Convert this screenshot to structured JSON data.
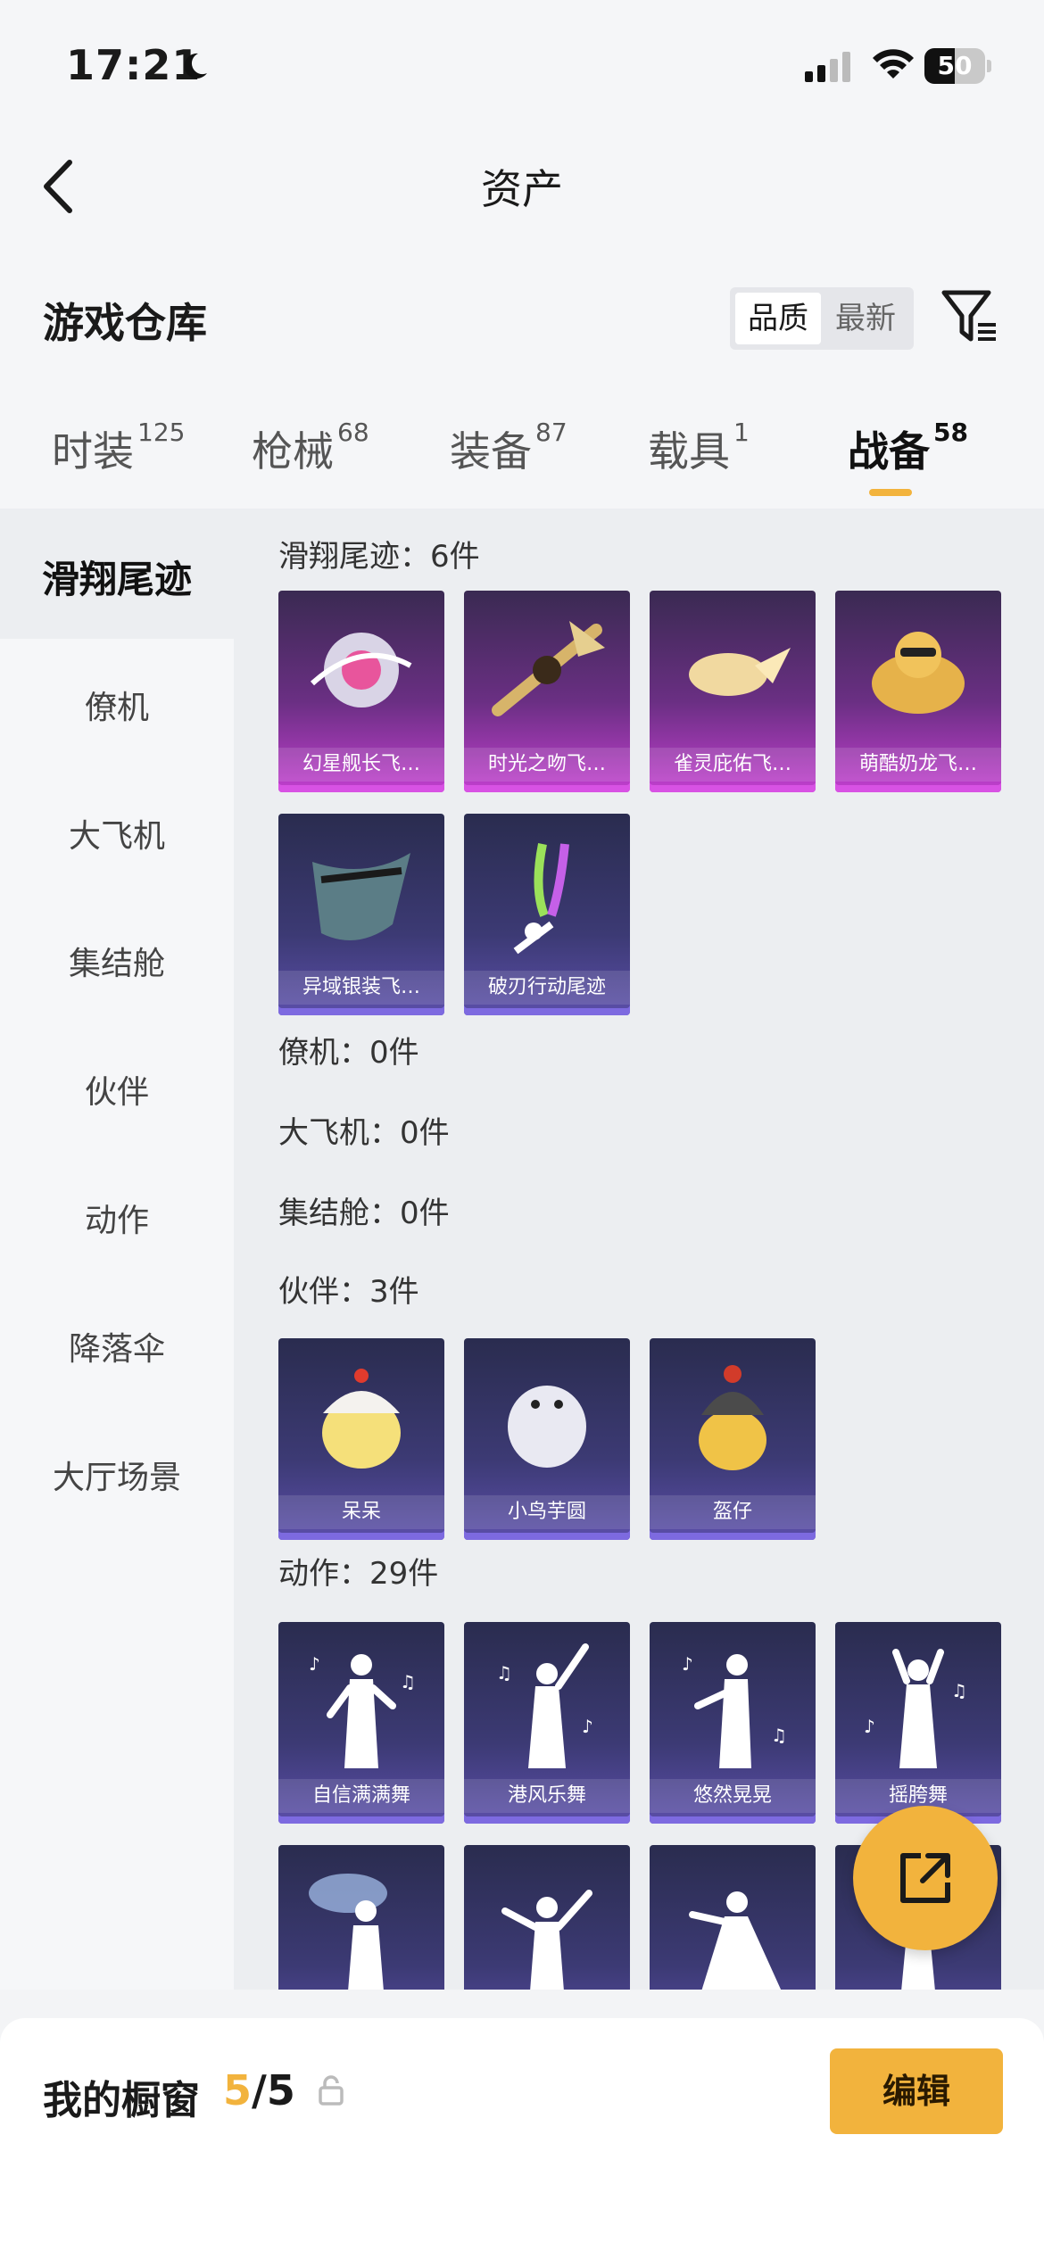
{
  "status": {
    "time": "17:21",
    "battery": "50",
    "battery_level": 0.5
  },
  "nav": {
    "title": "资产"
  },
  "header": {
    "title": "游戏仓库",
    "sort_options": [
      "品质",
      "最新"
    ]
  },
  "tabs": [
    {
      "label": "时装",
      "count": "125"
    },
    {
      "label": "枪械",
      "count": "68"
    },
    {
      "label": "装备",
      "count": "87"
    },
    {
      "label": "载具",
      "count": "1"
    },
    {
      "label": "战备",
      "count": "58"
    }
  ],
  "sidebar": {
    "items": [
      "滑翔尾迹",
      "僚机",
      "大飞机",
      "集结舱",
      "伙伴",
      "动作",
      "降落伞",
      "大厅场景"
    ]
  },
  "groups": {
    "trail": {
      "label": "滑翔尾迹：6件",
      "items": [
        "幻星舰长飞…",
        "时光之吻飞…",
        "雀灵庇佑飞…",
        "萌酷奶龙飞…",
        "异域银装飞…",
        "破刃行动尾迹"
      ]
    },
    "wingman": {
      "label": "僚机：0件"
    },
    "plane": {
      "label": "大飞机：0件"
    },
    "pod": {
      "label": "集结舱：0件"
    },
    "partner": {
      "label": "伙伴：3件",
      "items": [
        "呆呆",
        "小鸟芋圆",
        "盔仔"
      ]
    },
    "emote": {
      "label": "动作：29件",
      "items": [
        "自信满满舞",
        "港风乐舞",
        "悠然晃晃",
        "摇胯舞"
      ]
    }
  },
  "footer": {
    "label": "我的橱窗",
    "count_current": "5",
    "count_total": "/5",
    "edit_label": "编辑"
  },
  "colors": {
    "accent": "#f2b33d",
    "card_pink": "#c23fcf",
    "card_blue": "#5b4ea9"
  }
}
